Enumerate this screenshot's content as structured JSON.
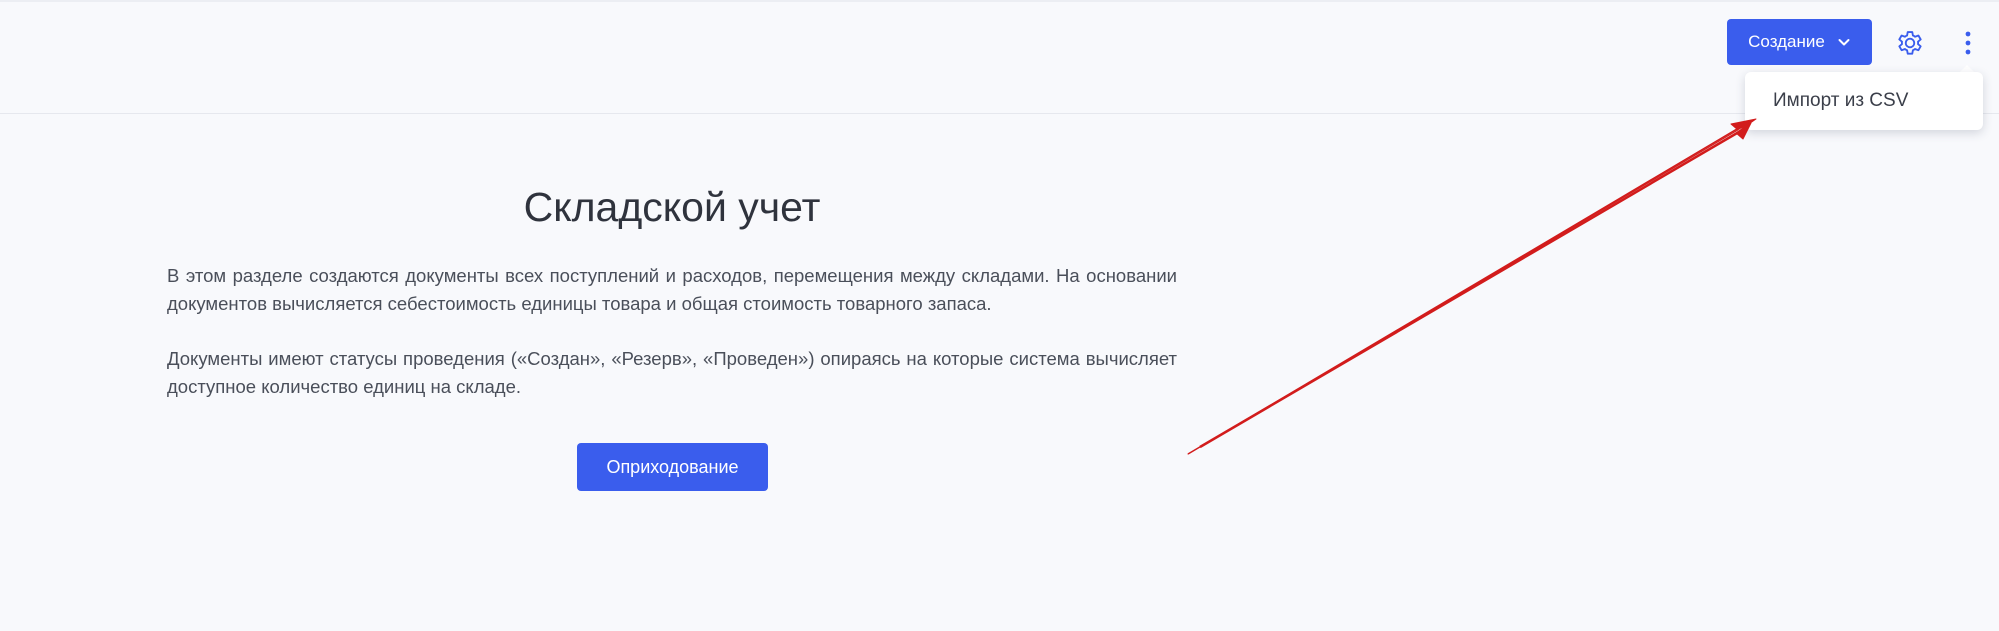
{
  "header": {
    "create_button_label": "Создание",
    "icons": [
      "chevron-down-icon",
      "gear-icon",
      "more-vertical-icon"
    ]
  },
  "dropdown": {
    "items": [
      {
        "label": "Импорт из CSV"
      }
    ]
  },
  "main": {
    "title": "Складской учет",
    "paragraphs": [
      "В этом разделе создаются документы всех поступлений и расходов, перемещения между складами. На основании документов вычисляется себестоимость единицы товара и общая стоимость товарного запаса.",
      "Документы имеют статусы проведения («Создан», «Резерв», «Проведен») опираясь на которые система вычисляет доступное количество единиц на складе."
    ],
    "intake_button_label": "Оприходование"
  },
  "colors": {
    "accent": "#3a5ded",
    "annotation_arrow": "#d21c1c",
    "background": "#f8f9fc"
  }
}
